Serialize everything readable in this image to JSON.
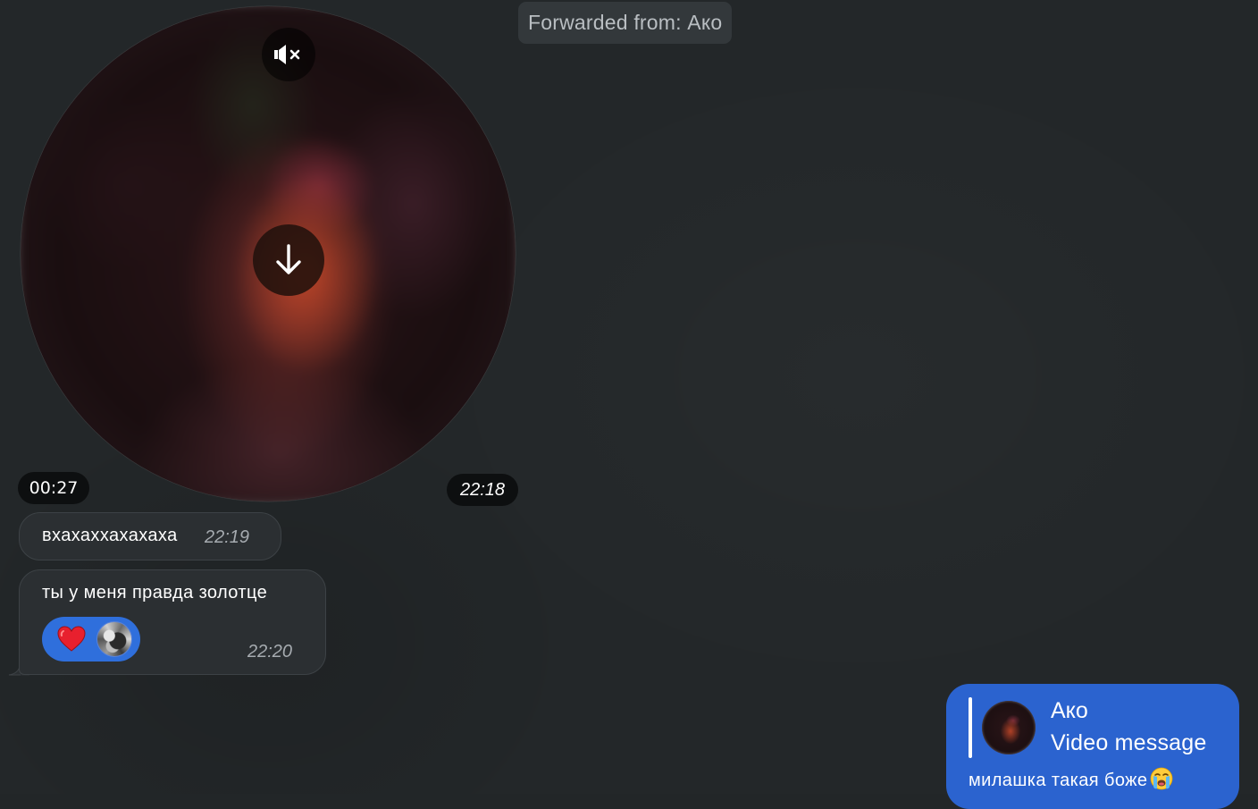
{
  "forwarded": {
    "label": "Forwarded from: Ако"
  },
  "video_message": {
    "duration": "00:27",
    "time": "22:18",
    "mute_icon": "speaker-muted-icon",
    "download_icon": "arrow-down-icon"
  },
  "messages": [
    {
      "text": "вхахаххахахаха",
      "time": "22:19"
    },
    {
      "text": "ты у меня правда золотце",
      "time": "22:20",
      "reaction": {
        "emoji_icon": "red-heart-icon",
        "reactor_avatar": "avatar"
      }
    }
  ],
  "outgoing": {
    "reply": {
      "name": "Ако",
      "type": "Video message"
    },
    "text": "милашка такая боже",
    "emoji_icon": "crying-face-icon"
  },
  "colors": {
    "background": "#232729",
    "incoming_bubble": "#2b2f32",
    "outgoing_bubble": "#2b63cf",
    "reaction_pill": "#2f6fdc",
    "timestamp_text": "#a6abb0"
  }
}
